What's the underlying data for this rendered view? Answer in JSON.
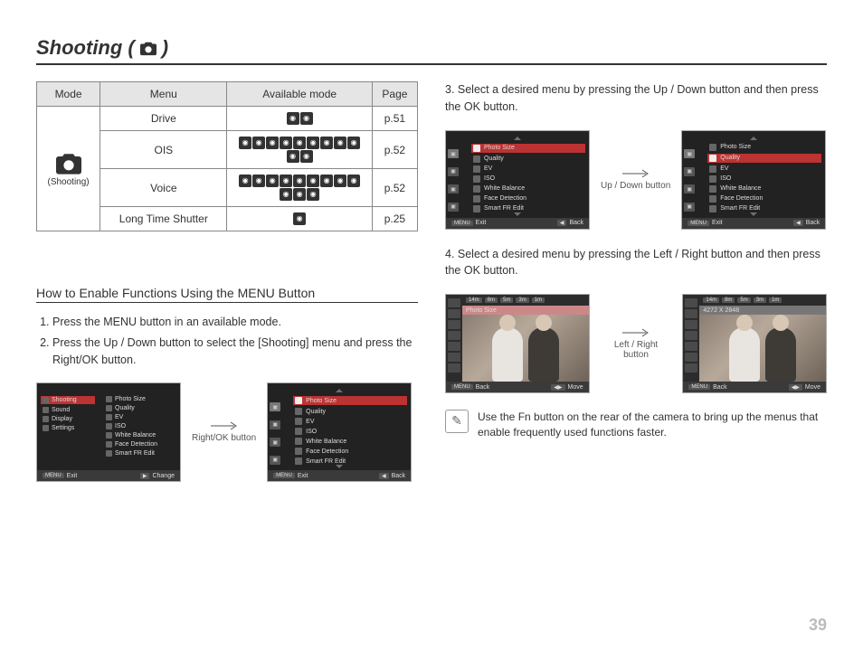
{
  "title_prefix": "Shooting (",
  "title_suffix": " )",
  "table": {
    "headers": {
      "mode": "Mode",
      "menu": "Menu",
      "avail": "Available mode",
      "page": "Page"
    },
    "mode_label": "(Shooting)",
    "rows": [
      {
        "menu": "Drive",
        "page": "p.51",
        "icons": 2
      },
      {
        "menu": "OIS",
        "page": "p.52",
        "icons": 11
      },
      {
        "menu": "Voice",
        "page": "p.52",
        "icons": 12
      },
      {
        "menu": "Long Time Shutter",
        "page": "p.25",
        "icons": 1
      }
    ]
  },
  "subheading": "How to Enable Functions Using the MENU Button",
  "left_steps": [
    "Press the MENU button in an available mode.",
    "Press the Up / Down button to select the [Shooting] menu and press the Right/OK button."
  ],
  "arrow_labels": {
    "right_ok": "Right/OK button",
    "up_down": "Up / Down button",
    "left_right": "Left / Right button"
  },
  "right_steps": {
    "s3": "3. Select a desired menu by pressing the Up / Down button and then press the OK button.",
    "s4": "4. Select a desired menu by pressing the Left / Right button and then press the OK button."
  },
  "lcd": {
    "left_menu": [
      "Shooting",
      "Sound",
      "Display",
      "Settings"
    ],
    "menu_items": [
      "Photo Size",
      "Quality",
      "EV",
      "ISO",
      "White Balance",
      "Face Detection",
      "Smart FR Edit"
    ],
    "footer_exit": "Exit",
    "footer_change": "Change",
    "footer_back": "Back",
    "footer_move": "Move",
    "photo_label_a": "Photo Size",
    "photo_label_b": "4272 X 2848",
    "size_tokens": [
      "14m",
      "8m",
      "5m",
      "3m",
      "1m"
    ]
  },
  "note": "Use the Fn button on the rear of the camera to bring up the menus that enable frequently used functions faster.",
  "page_number": "39"
}
